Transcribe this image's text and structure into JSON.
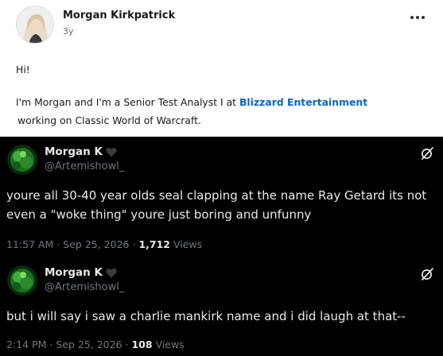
{
  "linkedin_post": {
    "author_name": "Morgan Kirkpatrick",
    "posted_ago": "3y",
    "greeting": "Hi!",
    "intro_before_link": "I'm Morgan and I'm a Senior Test Analyst I at ",
    "company_link": "Blizzard Entertainment",
    "intro_after_link": "working on Classic World of Warcraft."
  },
  "tweets": [
    {
      "display_name": "Morgan K",
      "name_icon": "black-heart-icon",
      "handle": "@Artemishowl_",
      "text_line1": "youre all 30-40 year olds seal clapping at the name Ray Getard its not",
      "text_line2": "even a \"woke thing\" youre just boring and unfunny",
      "time": "11:57 AM",
      "date": "Sep 25, 2026",
      "views_count": "1,712",
      "views_label": "Views"
    },
    {
      "display_name": "Morgan K",
      "name_icon": "black-heart-icon",
      "handle": "@Artemishowl_",
      "text": "but i will say i saw a charlie mankirk name and i did  laugh at that--",
      "time": "2:14 PM",
      "date": "Sep 25, 2026",
      "views_count": "108",
      "views_label": "Views"
    }
  ],
  "separator": "·",
  "colors": {
    "link_blue": "#0a66c2",
    "x_background": "#000000",
    "x_text": "#e7e9ea",
    "x_secondary": "#71767b"
  }
}
